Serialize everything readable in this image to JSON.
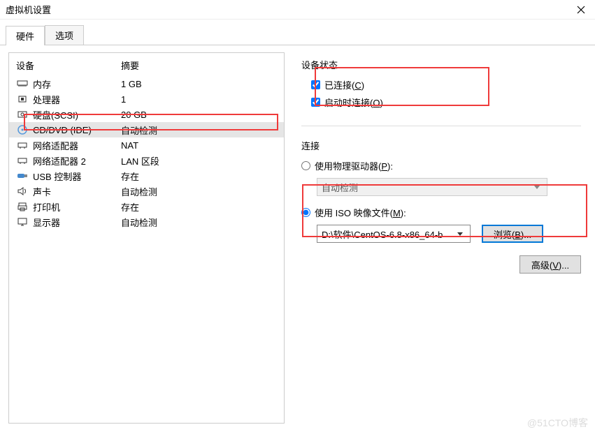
{
  "title": "虚拟机设置",
  "tabs": {
    "hardware": "硬件",
    "options": "选项"
  },
  "header": {
    "device": "设备",
    "summary": "摘要"
  },
  "hardware": [
    {
      "name": "内存",
      "summary": "1 GB",
      "icon": "memory"
    },
    {
      "name": "处理器",
      "summary": "1",
      "icon": "cpu"
    },
    {
      "name": "硬盘(SCSI)",
      "summary": "20 GB",
      "icon": "hdd"
    },
    {
      "name": "CD/DVD (IDE)",
      "summary": "自动检测",
      "icon": "disc",
      "selected": true
    },
    {
      "name": "网络适配器",
      "summary": "NAT",
      "icon": "net"
    },
    {
      "name": "网络适配器 2",
      "summary": "LAN 区段",
      "icon": "net"
    },
    {
      "name": "USB 控制器",
      "summary": "存在",
      "icon": "usb"
    },
    {
      "name": "声卡",
      "summary": "自动检测",
      "icon": "sound"
    },
    {
      "name": "打印机",
      "summary": "存在",
      "icon": "printer"
    },
    {
      "name": "显示器",
      "summary": "自动检测",
      "icon": "display"
    }
  ],
  "status": {
    "label": "设备状态",
    "connected": "已连接(",
    "connected_key": "C",
    "at_startup": "启动时连接(",
    "at_startup_key": "O"
  },
  "connection": {
    "label": "连接",
    "physical": "使用物理驱动器(",
    "physical_key": "P",
    "auto_detect": "自动检测",
    "iso": "使用 ISO 映像文件(",
    "iso_key": "M",
    "iso_path": "D:\\软件\\CentOS-6.8-x86_64-b",
    "browse": "浏览(",
    "browse_key": "B",
    "browse_suffix": ")...",
    "advanced": "高级(",
    "advanced_key": "V",
    "advanced_suffix": ")..."
  },
  "watermark": "@51CTO博客"
}
